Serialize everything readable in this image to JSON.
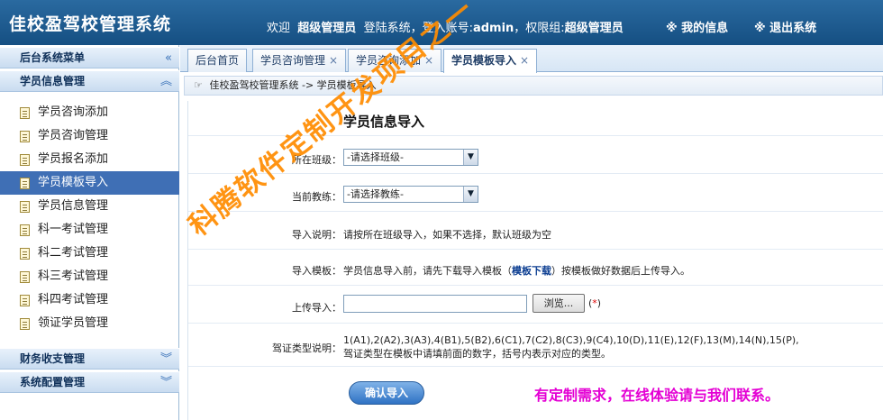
{
  "header": {
    "app_title": "佳校盈驾校管理系统",
    "welcome_text": "欢迎",
    "username": "超级管理员",
    "login_text": "登陆系统，登入账号:",
    "account": "admin",
    "role_text": "，权限组:",
    "role": "超级管理员",
    "my_info": "※ 我的信息",
    "logout": "※ 退出系统"
  },
  "sidebar": {
    "menu_title": "后台系统菜单",
    "menu_title_ctl": "«",
    "group_student": "学员信息管理",
    "group_student_ctl": "︽",
    "items": [
      {
        "label": "学员咨询添加"
      },
      {
        "label": "学员咨询管理"
      },
      {
        "label": "学员报名添加"
      },
      {
        "label": "学员模板导入"
      },
      {
        "label": "学员信息管理"
      },
      {
        "label": "科一考试管理"
      },
      {
        "label": "科二考试管理"
      },
      {
        "label": "科三考试管理"
      },
      {
        "label": "科四考试管理"
      },
      {
        "label": "领证学员管理"
      }
    ],
    "group_finance": "财务收支管理",
    "group_finance_ctl": "︾",
    "group_config": "系统配置管理",
    "group_config_ctl": "︾"
  },
  "tabs": [
    {
      "label": "后台首页",
      "close": ""
    },
    {
      "label": "学员咨询管理",
      "close": "×"
    },
    {
      "label": "学员咨询添加",
      "close": "×"
    },
    {
      "label": "学员模板导入",
      "close": "×"
    }
  ],
  "breadcrumb": "佳校盈驾校管理系统 -> 学员模板导入",
  "form": {
    "title": "学员信息导入",
    "class_label": "所在班级：",
    "class_value": "-请选择班级-",
    "coach_label": "当前教练：",
    "coach_value": "-请选择教练-",
    "note_label": "导入说明：",
    "note_text": "请按所在班级导入，如果不选择，默认班级为空",
    "template_label": "导入模板：",
    "template_text_pre": "学员信息导入前，请先下载导入模板（",
    "template_link": "模板下载",
    "template_text_post": "）按模板做好数据后上传导入。",
    "upload_label": "上传导入：",
    "browse_label": "浏览...",
    "required_pre": "(",
    "required_star": "*",
    "required_post": ")",
    "license_label": "驾证类型说明：",
    "license_line1": "1(A1),2(A2),3(A3),4(B1),5(B2),6(C1),7(C2),8(C3),9(C4),10(D),11(E),12(F),13(M),14(N),15(P),",
    "license_line2": "驾证类型在模板中请填前面的数字，括号内表示对应的类型。",
    "submit_label": "确认导入"
  },
  "promo_text": "有定制需求，在线体验请与我们联系。",
  "watermark_text": "科腾软件定制开发项目之一",
  "colors": {
    "header_bg": "#1f5e93",
    "active_item": "#3f6fb5",
    "watermark": "#ff8c00",
    "promo": "#e400d4"
  }
}
